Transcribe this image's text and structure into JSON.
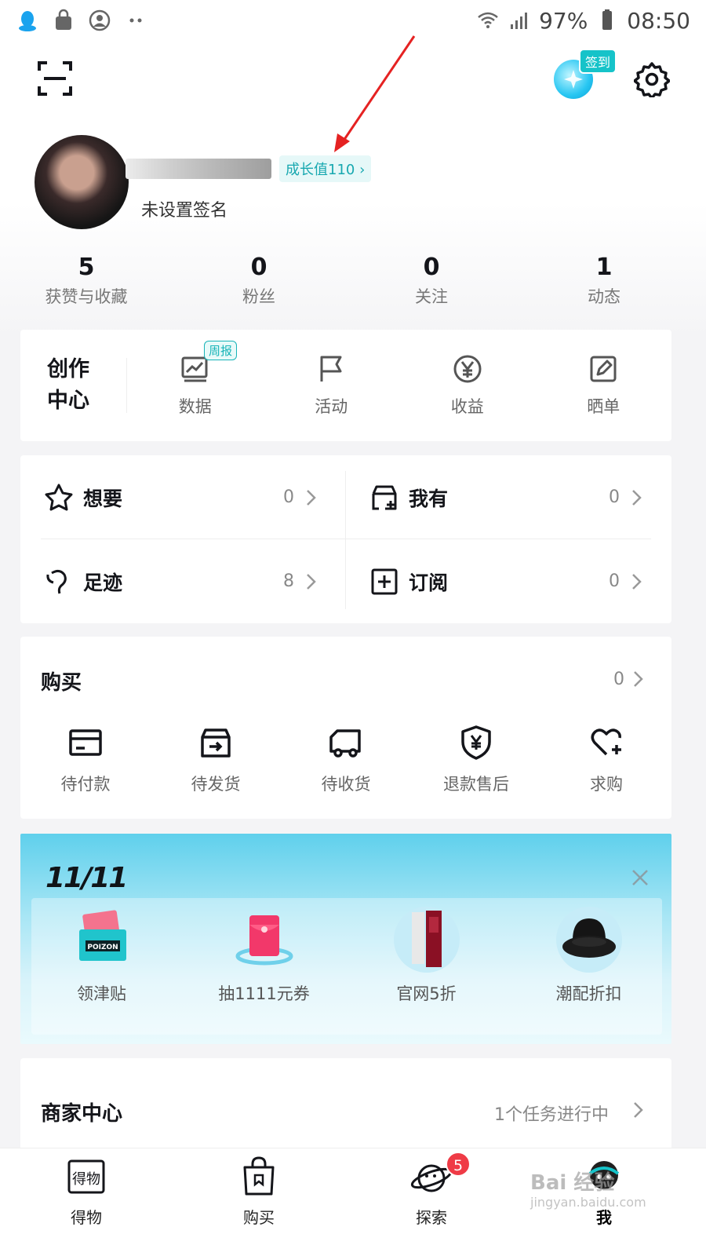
{
  "status_bar": {
    "battery": "97%",
    "time": "08:50"
  },
  "header": {
    "checkin_badge": "签到"
  },
  "profile": {
    "growth_value": "成长值110 ›",
    "signature": "未设置签名"
  },
  "stats": [
    {
      "value": "5",
      "label": "获赞与收藏"
    },
    {
      "value": "0",
      "label": "粉丝"
    },
    {
      "value": "0",
      "label": "关注"
    },
    {
      "value": "1",
      "label": "动态"
    }
  ],
  "creation_center": {
    "title_line1": "创作",
    "title_line2": "中心",
    "weekly_badge": "周报",
    "items": [
      {
        "label": "数据",
        "icon": "data-chart-icon"
      },
      {
        "label": "活动",
        "icon": "flag-icon"
      },
      {
        "label": "收益",
        "icon": "yuan-coin-icon"
      },
      {
        "label": "晒单",
        "icon": "edit-post-icon"
      }
    ]
  },
  "collections": [
    {
      "label": "想要",
      "count": "0",
      "icon": "star-icon"
    },
    {
      "label": "我有",
      "count": "0",
      "icon": "box-plus-icon"
    },
    {
      "label": "足迹",
      "count": "8",
      "icon": "footprint-icon"
    },
    {
      "label": "订阅",
      "count": "0",
      "icon": "subscribe-plus-icon"
    }
  ],
  "purchase": {
    "title": "购买",
    "count": "0",
    "items": [
      {
        "label": "待付款",
        "icon": "card-icon"
      },
      {
        "label": "待发货",
        "icon": "box-out-icon"
      },
      {
        "label": "待收货",
        "icon": "truck-icon"
      },
      {
        "label": "退款售后",
        "icon": "shield-yuan-icon"
      },
      {
        "label": "求购",
        "icon": "heart-plus-icon"
      }
    ]
  },
  "promo": {
    "logo": "11/11",
    "items": [
      {
        "label": "领津贴",
        "icon": "poizon-tickets-icon",
        "brand": "POIZON"
      },
      {
        "label": "抽1111元券",
        "icon": "red-envelope-icon"
      },
      {
        "label": "官网5折",
        "icon": "skincare-bottle-icon"
      },
      {
        "label": "潮配折扣",
        "icon": "bucket-hat-icon"
      }
    ]
  },
  "merchant": {
    "title": "商家中心",
    "status": "1个任务进行中"
  },
  "tabbar": {
    "tabs": [
      {
        "label": "得物",
        "glyph": "得物"
      },
      {
        "label": "购买"
      },
      {
        "label": "探索",
        "badge": "5"
      },
      {
        "label": "我"
      }
    ]
  },
  "watermark": {
    "text": "Bai 经验",
    "sub": "jingyan.baidu.com"
  },
  "colors": {
    "accent": "#16c3c9",
    "badge_red": "#ef3b46",
    "annotation_red": "#e52222"
  }
}
